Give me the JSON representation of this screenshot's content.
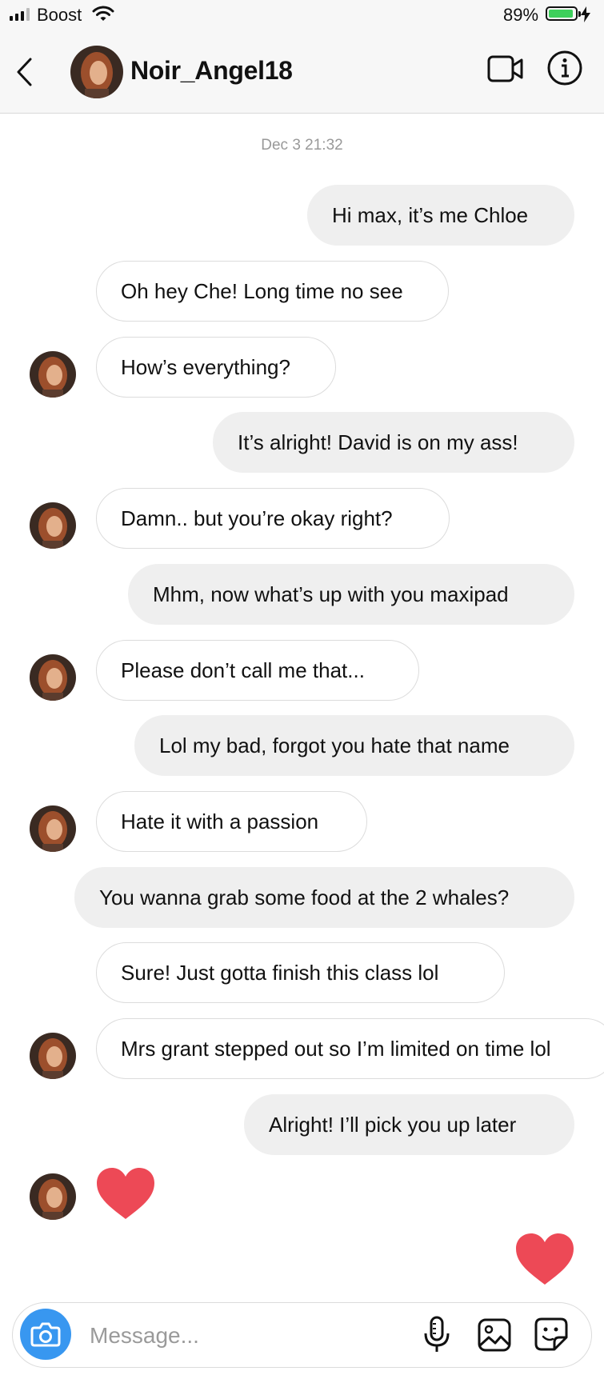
{
  "status_bar": {
    "carrier": "Boost",
    "battery_percent": "89%",
    "battery_level": 0.89,
    "battery_color": "#3ed05c"
  },
  "header": {
    "title": "Noir_Angel18",
    "icons": [
      "back-chevron-icon",
      "video-camera-icon",
      "info-icon"
    ]
  },
  "thread": {
    "timestamp": "Dec 3 21:32",
    "messages": [
      {
        "from": "me",
        "text": "Hi max, it’s me Chloe"
      },
      {
        "from": "them",
        "text": "Oh hey Che! Long time no see"
      },
      {
        "from": "them",
        "text": "How’s everything?"
      },
      {
        "from": "me",
        "text": "It’s alright! David is on my ass!"
      },
      {
        "from": "them",
        "text": "Damn.. but you’re okay right?"
      },
      {
        "from": "me",
        "text": "Mhm, now what’s up with you maxipad"
      },
      {
        "from": "them",
        "text": "Please don’t call me that..."
      },
      {
        "from": "me",
        "text": "Lol my bad, forgot you hate that name"
      },
      {
        "from": "them",
        "text": "Hate it with a passion"
      },
      {
        "from": "me",
        "text": "You wanna grab some food at the 2 whales?"
      },
      {
        "from": "them",
        "text": "Sure! Just gotta finish this class lol"
      },
      {
        "from": "them",
        "text": "Mrs grant stepped out so I’m limited on time lol"
      },
      {
        "from": "me",
        "text": "Alright! I’ll pick you up later"
      },
      {
        "from": "them",
        "reaction": "heart"
      },
      {
        "from": "me",
        "reaction": "heart"
      }
    ],
    "heart_color": "#ed4956",
    "outgoing_bubble_color": "#efefef"
  },
  "composer": {
    "placeholder": "Message...",
    "camera_color": "#3897f0",
    "icons": [
      "camera-icon",
      "microphone-icon",
      "gallery-icon",
      "sticker-icon"
    ]
  }
}
